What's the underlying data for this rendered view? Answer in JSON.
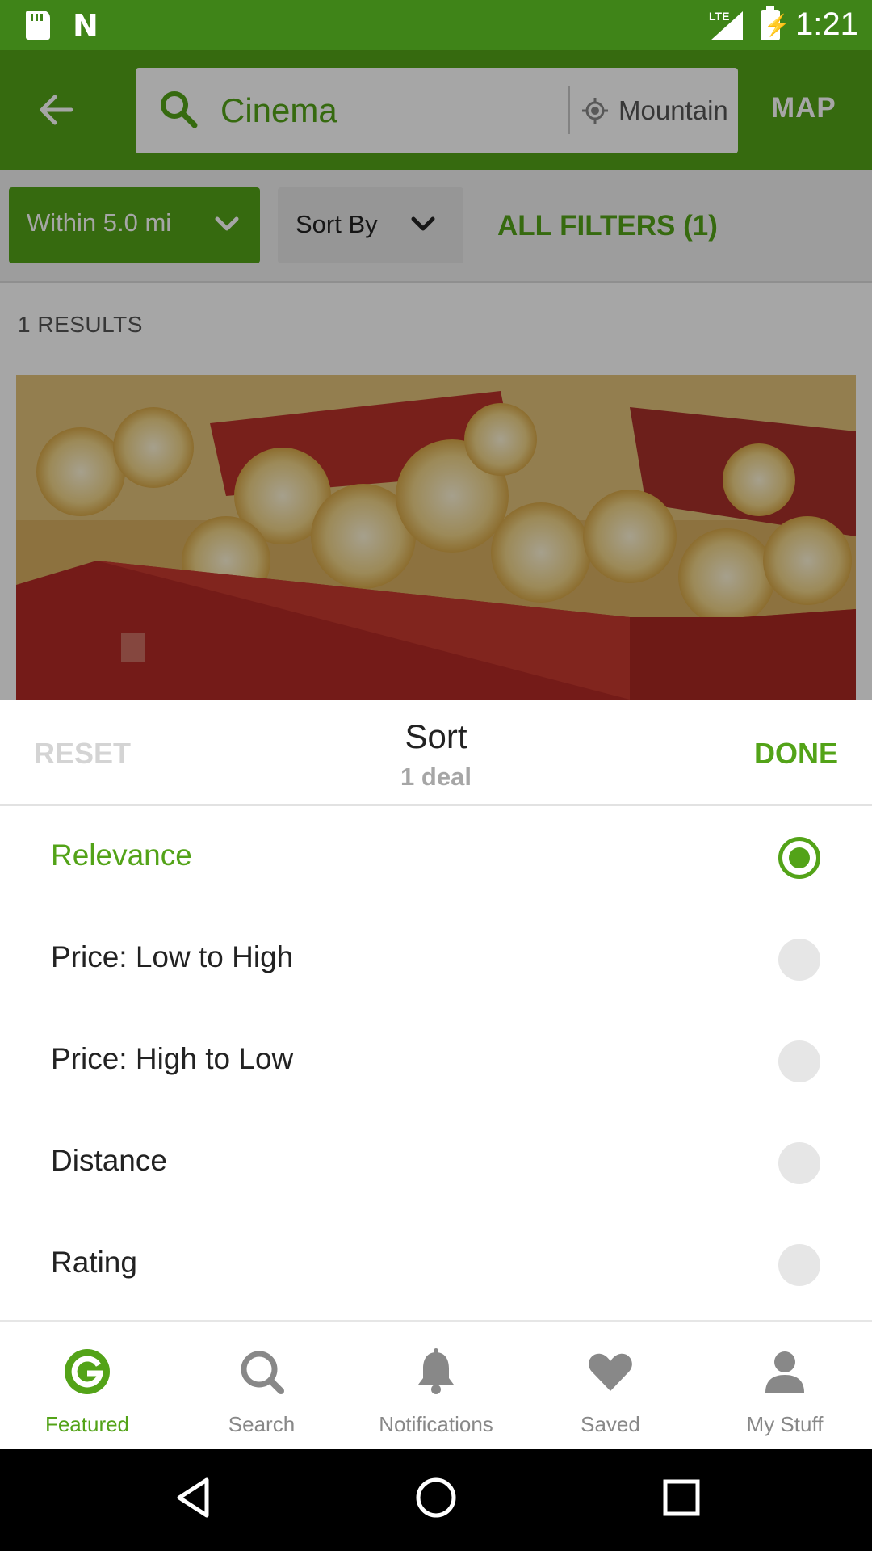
{
  "status_bar": {
    "time": "1:21",
    "network": "LTE"
  },
  "app_bar": {
    "search_query": "Cinema",
    "location": "Mountain View",
    "map_label": "MAP"
  },
  "filters": {
    "within_label": "Within 5.0 mi",
    "sort_label": "Sort By",
    "all_filters_label": "ALL FILTERS (1)"
  },
  "results": {
    "count_label": "1 RESULTS"
  },
  "sort_sheet": {
    "reset_label": "RESET",
    "title": "Sort",
    "subtitle": "1 deal",
    "done_label": "DONE",
    "options": [
      {
        "label": "Relevance",
        "selected": true
      },
      {
        "label": "Price: Low to High",
        "selected": false
      },
      {
        "label": "Price: High to Low",
        "selected": false
      },
      {
        "label": "Distance",
        "selected": false
      },
      {
        "label": "Rating",
        "selected": false
      }
    ]
  },
  "bottom_nav": {
    "items": [
      {
        "label": "Featured",
        "icon": "groupon-g-icon",
        "active": true
      },
      {
        "label": "Search",
        "icon": "search-icon",
        "active": false
      },
      {
        "label": "Notifications",
        "icon": "bell-icon",
        "active": false
      },
      {
        "label": "Saved",
        "icon": "heart-icon",
        "active": false
      },
      {
        "label": "My Stuff",
        "icon": "person-icon",
        "active": false
      }
    ]
  },
  "colors": {
    "brand_green": "#53a318",
    "status_bar_green": "#3f8418",
    "inactive_gray": "#888888"
  }
}
